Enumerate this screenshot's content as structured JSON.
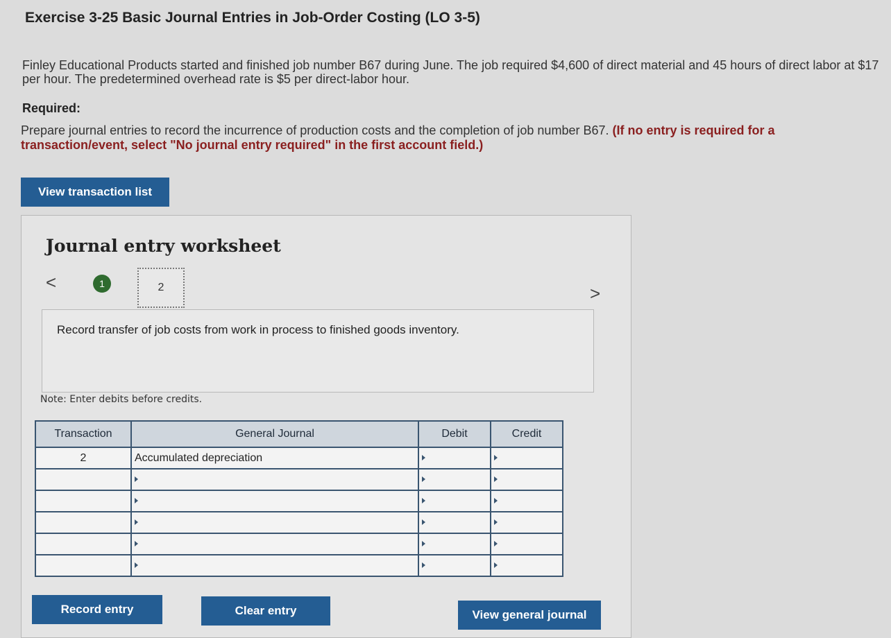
{
  "header": {
    "title": "Exercise 3-25 Basic Journal Entries in Job-Order Costing (LO 3-5)"
  },
  "problem": {
    "intro": "Finley Educational Products started and finished job number B67 during June. The job required $4,600 of direct material and 45 hours of direct labor at $17 per hour. The predetermined overhead rate is $5 per direct-labor hour.",
    "required_label": "Required:",
    "required_text": "Prepare journal entries to record the incurrence of production costs and the completion of job number B67.",
    "required_emphasis": "(If no entry is required for a transaction/event, select \"No journal entry required\" in the first account field.)"
  },
  "buttons": {
    "view_transaction_list": "View transaction list",
    "record_entry": "Record entry",
    "clear_entry": "Clear entry",
    "view_general_journal": "View general journal"
  },
  "worksheet": {
    "title": "Journal entry worksheet",
    "prev_glyph": "<",
    "next_glyph": ">",
    "steps": [
      {
        "label": "1",
        "state": "completed"
      },
      {
        "label": "2",
        "state": "current"
      }
    ],
    "description": "Record transfer of job costs from work in process to finished goods inventory.",
    "note": "Note: Enter debits before credits."
  },
  "journal_table": {
    "headers": [
      "Transaction",
      "General Journal",
      "Debit",
      "Credit"
    ],
    "rows": [
      {
        "transaction": "2",
        "account": "Accumulated depreciation",
        "debit": "",
        "credit": ""
      },
      {
        "transaction": "",
        "account": "",
        "debit": "",
        "credit": ""
      },
      {
        "transaction": "",
        "account": "",
        "debit": "",
        "credit": ""
      },
      {
        "transaction": "",
        "account": "",
        "debit": "",
        "credit": ""
      },
      {
        "transaction": "",
        "account": "",
        "debit": "",
        "credit": ""
      },
      {
        "transaction": "",
        "account": "",
        "debit": "",
        "credit": ""
      }
    ]
  },
  "colors": {
    "button_blue": "#245d93",
    "step_done_green": "#2f6b2f",
    "emphasis_red": "#8a1f1f",
    "table_border": "#3a5570"
  }
}
